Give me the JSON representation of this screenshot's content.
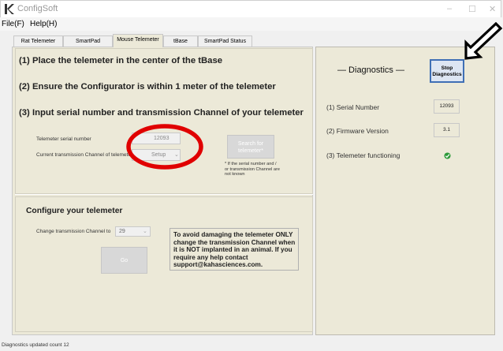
{
  "window": {
    "title": "ConfigSoft",
    "minimize": "–",
    "maximize": "☐",
    "close": "✕"
  },
  "menu": {
    "file": "File(F)",
    "help": "Help(H)"
  },
  "tabs": [
    {
      "label": "Rat Telemeter"
    },
    {
      "label": "SmartPad"
    },
    {
      "label": "Mouse Telemeter"
    },
    {
      "label": "tBase"
    },
    {
      "label": "SmartPad Status"
    }
  ],
  "instructions": {
    "step1": "(1) Place the telemeter in the center of the tBase",
    "step2": "(2) Ensure the Configurator is within 1 meter of the telemeter",
    "step3": "(3) Input serial number and transmission Channel of your telemeter"
  },
  "search": {
    "serial_label": "Telemeter serial number",
    "serial_value": "12093",
    "channel_label": "Current transmission Channel of telemeter",
    "channel_value": "Setup",
    "search_button": "Search for telemeter*",
    "note": "* If the serial number and / or transmission Channel are not known"
  },
  "configure": {
    "heading": "Configure your telemeter",
    "channel_label": "Change transmission Channel to",
    "channel_value": "29",
    "go_button": "Go",
    "warning": "To avoid damaging the telemeter ONLY change the transmission Channel when it is NOT implanted in an animal.  If you require any help contact support@kahasciences.com."
  },
  "diagnostics": {
    "title": "— Diagnostics —",
    "stop_button": "Stop Diagnostics",
    "serial_label": "(1) Serial Number",
    "serial_value": "12093",
    "firmware_label": "(2) Firmware Version",
    "firmware_value": "3.1",
    "functioning_label": "(3) Telemeter functioning"
  },
  "status": {
    "text": "Diagnostics updated count 12"
  },
  "colors": {
    "annotation_circle": "#e00000",
    "status_ok": "#2e9a3a",
    "stop_button_border": "#3f6fb5"
  }
}
